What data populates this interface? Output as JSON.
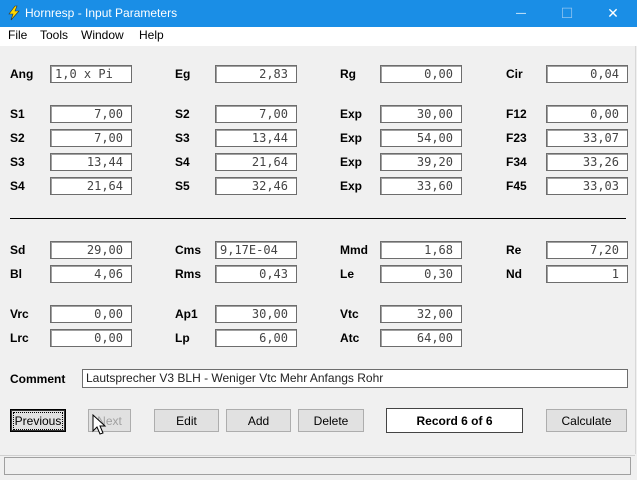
{
  "window": {
    "title": "Hornresp - Input Parameters",
    "minimize_glyph": "—",
    "maximize_glyph": "☐",
    "close_glyph": "✕"
  },
  "menu": [
    "File",
    "Tools",
    "Window",
    "Help"
  ],
  "rows": {
    "row1": [
      {
        "label": "Ang",
        "value": "1,0 x Pi"
      },
      {
        "label": "Eg",
        "value": "2,83"
      },
      {
        "label": "Rg",
        "value": "0,00"
      },
      {
        "label": "Cir",
        "value": "0,04"
      }
    ],
    "horn": [
      [
        {
          "label": "S1",
          "value": "7,00"
        },
        {
          "label": "S2",
          "value": "7,00"
        },
        {
          "label": "Exp",
          "value": "30,00"
        },
        {
          "label": "F12",
          "value": "0,00"
        }
      ],
      [
        {
          "label": "S2",
          "value": "7,00"
        },
        {
          "label": "S3",
          "value": "13,44"
        },
        {
          "label": "Exp",
          "value": "54,00"
        },
        {
          "label": "F23",
          "value": "33,07"
        }
      ],
      [
        {
          "label": "S3",
          "value": "13,44"
        },
        {
          "label": "S4",
          "value": "21,64"
        },
        {
          "label": "Exp",
          "value": "39,20"
        },
        {
          "label": "F34",
          "value": "33,26"
        }
      ],
      [
        {
          "label": "S4",
          "value": "21,64"
        },
        {
          "label": "S5",
          "value": "32,46"
        },
        {
          "label": "Exp",
          "value": "33,60"
        },
        {
          "label": "F45",
          "value": "33,03"
        }
      ]
    ],
    "driver": [
      [
        {
          "label": "Sd",
          "value": "29,00"
        },
        {
          "label": "Cms",
          "value": "9,17E-04"
        },
        {
          "label": "Mmd",
          "value": "1,68"
        },
        {
          "label": "Re",
          "value": "7,20"
        }
      ],
      [
        {
          "label": "Bl",
          "value": "4,06"
        },
        {
          "label": "Rms",
          "value": "0,43"
        },
        {
          "label": "Le",
          "value": "0,30"
        },
        {
          "label": "Nd",
          "value": "1"
        }
      ]
    ],
    "chamber": [
      [
        {
          "label": "Vrc",
          "value": "0,00"
        },
        {
          "label": "Ap1",
          "value": "30,00"
        },
        {
          "label": "Vtc",
          "value": "32,00"
        }
      ],
      [
        {
          "label": "Lrc",
          "value": "0,00"
        },
        {
          "label": "Lp",
          "value": "6,00"
        },
        {
          "label": "Atc",
          "value": "64,00"
        }
      ]
    ]
  },
  "comment": {
    "label": "Comment",
    "value": "Lautsprecher V3 BLH - Weniger Vtc Mehr Anfangs Rohr"
  },
  "buttons": {
    "previous": "Previous",
    "next": "Next",
    "edit": "Edit",
    "add": "Add",
    "delete": "Delete",
    "record": "Record 6 of 6",
    "calculate": "Calculate"
  },
  "colors": {
    "titlebar": "#1a8ee6",
    "background": "#f0f0f0"
  },
  "icons": {
    "app": "lightning-bolt-icon",
    "cursor": "mouse-pointer-icon"
  }
}
